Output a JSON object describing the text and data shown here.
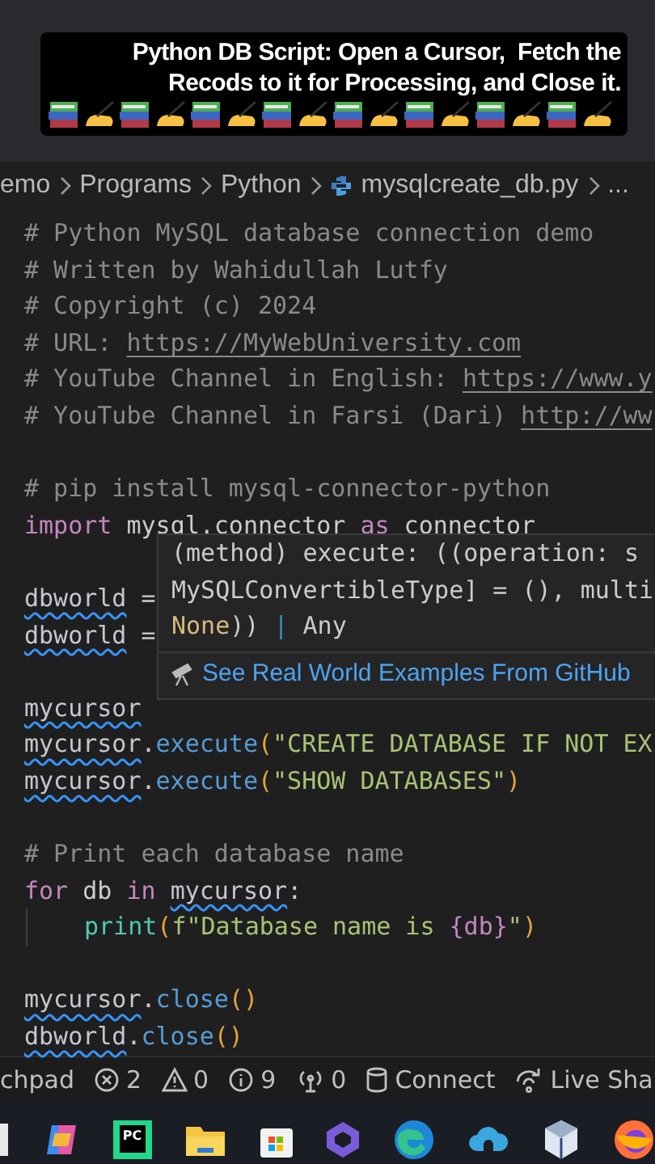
{
  "caption": {
    "lines": [
      "Python DB Script: Open a Cursor,  Fetch the",
      "Recods to it for Processing, and Close it."
    ],
    "emoji_row": [
      {
        "kind": "books"
      },
      {
        "kind": "writing"
      },
      {
        "kind": "books"
      },
      {
        "kind": "writing"
      },
      {
        "kind": "books"
      },
      {
        "kind": "writing"
      },
      {
        "kind": "books"
      },
      {
        "kind": "writing"
      },
      {
        "kind": "books"
      },
      {
        "kind": "writing"
      },
      {
        "kind": "books"
      },
      {
        "kind": "writing"
      },
      {
        "kind": "books"
      },
      {
        "kind": "writing"
      },
      {
        "kind": "books"
      },
      {
        "kind": "writing"
      }
    ]
  },
  "breadcrumb": [
    {
      "label": "emo",
      "kind": "folder"
    },
    {
      "label": "Programs",
      "kind": "folder"
    },
    {
      "label": "Python",
      "kind": "folder"
    },
    {
      "label": "mysqlcreate_db.py",
      "kind": "python-file"
    },
    {
      "label": "...",
      "kind": "more"
    }
  ],
  "editor": {
    "lines": [
      {
        "kind": "code",
        "tokens": [
          {
            "t": "# Python MySQL database connection demo",
            "kind": "comment"
          }
        ]
      },
      {
        "kind": "code",
        "tokens": [
          {
            "t": "# Written by Wahidullah Lutfy",
            "kind": "comment"
          }
        ]
      },
      {
        "kind": "code",
        "tokens": [
          {
            "t": "# Copyright (c) 2024",
            "kind": "comment"
          }
        ]
      },
      {
        "kind": "code",
        "tokens": [
          {
            "t": "# URL: ",
            "kind": "comment"
          },
          {
            "t": "https://MyWebUniversity.com",
            "kind": "link"
          }
        ]
      },
      {
        "kind": "code",
        "tokens": [
          {
            "t": "# YouTube Channel in English: ",
            "kind": "comment"
          },
          {
            "t": "https://www.y",
            "kind": "link"
          }
        ]
      },
      {
        "kind": "code",
        "tokens": [
          {
            "t": "# YouTube Channel in Farsi (Dari) ",
            "kind": "comment"
          },
          {
            "t": "http://ww",
            "kind": "link"
          }
        ]
      },
      {
        "kind": "blank"
      },
      {
        "kind": "code",
        "tokens": [
          {
            "t": "# pip install mysql-connector-python",
            "kind": "comment"
          }
        ]
      },
      {
        "kind": "code",
        "tokens": [
          {
            "t": "import",
            "kind": "keyword"
          },
          {
            "t": " mysql.connector ",
            "kind": "plain"
          },
          {
            "t": "as",
            "kind": "keyword"
          },
          {
            "t": " connector",
            "kind": "plain"
          }
        ]
      },
      {
        "kind": "blank"
      },
      {
        "kind": "code",
        "tokens": [
          {
            "t": "dbworld",
            "kind": "variable",
            "squiggle": true
          },
          {
            "t": " =",
            "kind": "plain"
          }
        ]
      },
      {
        "kind": "code",
        "tokens": [
          {
            "t": "dbworld",
            "kind": "variable",
            "squiggle": true
          },
          {
            "t": " =",
            "kind": "plain"
          }
        ]
      },
      {
        "kind": "blank"
      },
      {
        "kind": "code",
        "tokens": [
          {
            "t": "mycursor",
            "kind": "variable",
            "squiggle": true
          }
        ]
      },
      {
        "kind": "code",
        "tokens": [
          {
            "t": "mycursor",
            "kind": "variable",
            "squiggle": true
          },
          {
            "t": ".",
            "kind": "plain"
          },
          {
            "t": "execute",
            "kind": "function"
          },
          {
            "t": "(",
            "kind": "paren"
          },
          {
            "t": "\"CREATE DATABASE IF NOT EX",
            "kind": "string"
          }
        ]
      },
      {
        "kind": "code",
        "tokens": [
          {
            "t": "mycursor",
            "kind": "variable",
            "squiggle": true
          },
          {
            "t": ".",
            "kind": "plain"
          },
          {
            "t": "execute",
            "kind": "function"
          },
          {
            "t": "(",
            "kind": "paren"
          },
          {
            "t": "\"SHOW DATABASES\"",
            "kind": "string"
          },
          {
            "t": ")",
            "kind": "paren"
          }
        ]
      },
      {
        "kind": "blank"
      },
      {
        "kind": "code",
        "tokens": [
          {
            "t": "# Print each database name",
            "kind": "comment"
          }
        ]
      },
      {
        "kind": "code",
        "tokens": [
          {
            "t": "for",
            "kind": "keyword"
          },
          {
            "t": " db ",
            "kind": "plain"
          },
          {
            "t": "in ",
            "kind": "keyword"
          },
          {
            "t": "mycursor",
            "kind": "variable",
            "squiggle": true
          },
          {
            "t": ":",
            "kind": "plain"
          }
        ]
      },
      {
        "kind": "indented",
        "tokens": [
          {
            "t": "print",
            "kind": "builtin"
          },
          {
            "t": "(",
            "kind": "paren"
          },
          {
            "t": "f\"Database name is ",
            "kind": "string"
          },
          {
            "t": "{db}",
            "kind": "brace"
          },
          {
            "t": "\"",
            "kind": "string"
          },
          {
            "t": ")",
            "kind": "paren"
          }
        ]
      },
      {
        "kind": "blank"
      },
      {
        "kind": "code",
        "tokens": [
          {
            "t": "mycursor",
            "kind": "variable",
            "squiggle": true
          },
          {
            "t": ".",
            "kind": "plain"
          },
          {
            "t": "close",
            "kind": "function"
          },
          {
            "t": "()",
            "kind": "paren"
          }
        ]
      },
      {
        "kind": "code",
        "tokens": [
          {
            "t": "dbworld",
            "kind": "variable",
            "squiggle": true
          },
          {
            "t": ".",
            "kind": "plain"
          },
          {
            "t": "close",
            "kind": "function"
          },
          {
            "t": "()",
            "kind": "paren"
          }
        ]
      }
    ]
  },
  "hover": {
    "signature": [
      [
        {
          "t": "(method) execute: ((operation: s",
          "kind": "plain"
        }
      ],
      [
        {
          "t": "MySQLConvertibleType] = (), multi",
          "kind": "plain"
        }
      ],
      [
        {
          "t": "None",
          "kind": "constant"
        },
        {
          "t": ")) ",
          "kind": "plain"
        },
        {
          "t": "| ",
          "kind": "pipe"
        },
        {
          "t": "Any",
          "kind": "plain"
        }
      ]
    ],
    "link": "See Real World Examples From GitHub"
  },
  "status_bar": [
    {
      "kind": "text",
      "label": "chpad"
    },
    {
      "kind": "errors",
      "label": "2"
    },
    {
      "kind": "warnings",
      "label": "0"
    },
    {
      "kind": "info",
      "label": "9"
    },
    {
      "kind": "ports",
      "label": "0"
    },
    {
      "kind": "database",
      "label": "Connect"
    },
    {
      "kind": "share",
      "label": "Live Sha"
    }
  ],
  "taskbar": [
    {
      "kind": "partial"
    },
    {
      "kind": "copilot"
    },
    {
      "kind": "pycharm",
      "label": "PC"
    },
    {
      "kind": "folder"
    },
    {
      "kind": "store"
    },
    {
      "kind": "hexagon"
    },
    {
      "kind": "edge"
    },
    {
      "kind": "cloud"
    },
    {
      "kind": "cube"
    },
    {
      "kind": "firefox"
    }
  ]
}
